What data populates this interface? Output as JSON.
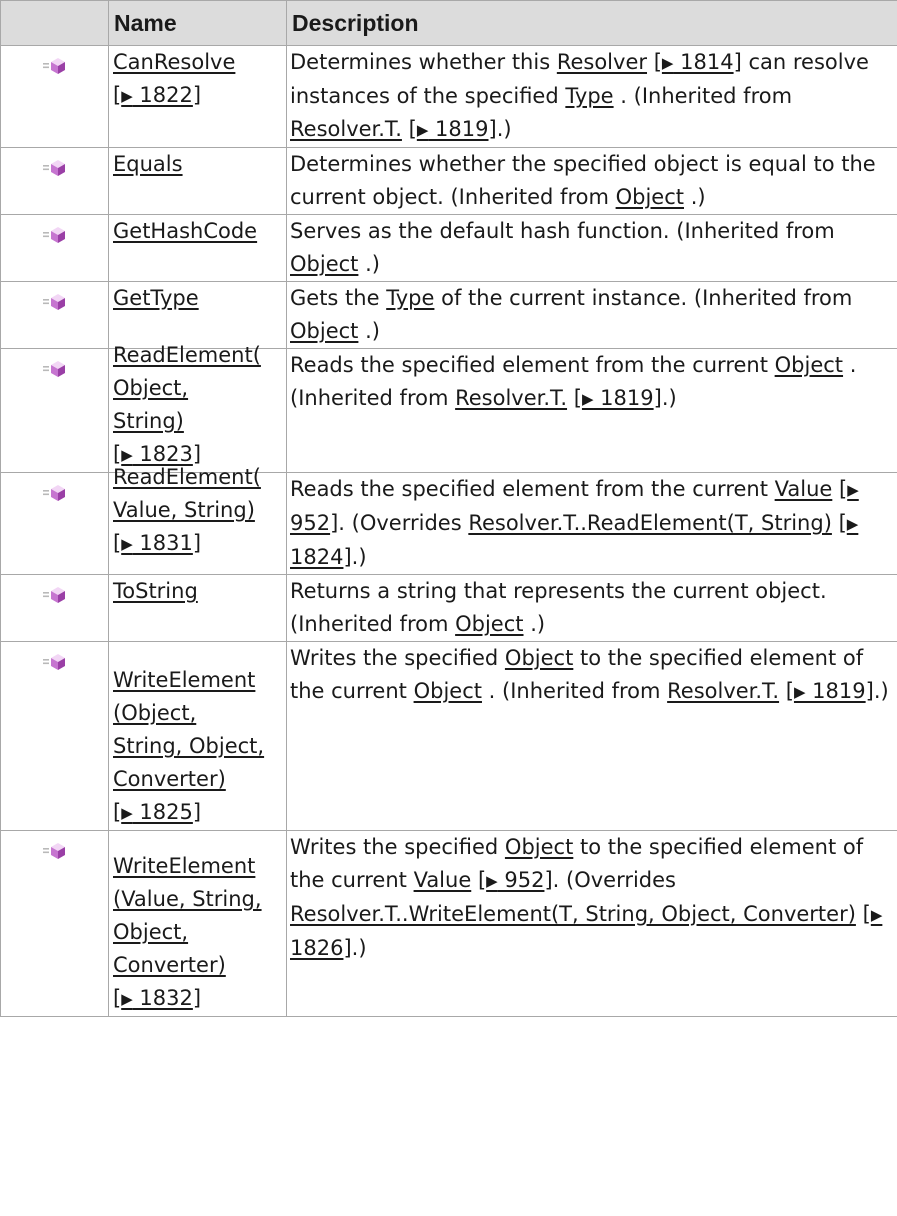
{
  "table": {
    "headers": {
      "icon": "",
      "name": "Name",
      "description": "Description"
    },
    "rows": [
      {
        "name": "CanResolve",
        "name_ref": "1822",
        "desc": [
          {
            "t": "Determines whether this "
          },
          {
            "t": "Resolver",
            "link": true
          },
          {
            "ref": "1814"
          },
          {
            "t": " can resolve instances of the specified "
          },
          {
            "t": "Type",
            "link": true
          },
          {
            "t": ". (Inherited from "
          },
          {
            "t": "Resolver.T.",
            "link": true
          },
          {
            "ref": "1819"
          },
          {
            "t": ".)"
          }
        ]
      },
      {
        "name": "Equals",
        "desc": [
          {
            "t": "Determines whether the specified object is equal to the current object. (Inherited from "
          },
          {
            "t": "Object",
            "link": true
          },
          {
            "t": ".)"
          }
        ]
      },
      {
        "name": "GetHashCode",
        "desc": [
          {
            "t": "Serves as the default hash function. (Inherited from "
          },
          {
            "t": "Object",
            "link": true
          },
          {
            "t": ".)"
          }
        ]
      },
      {
        "name": "GetType",
        "desc": [
          {
            "t": "Gets the "
          },
          {
            "t": "Type",
            "link": true
          },
          {
            "t": " of the current instance. (Inherited from "
          },
          {
            "t": "Object",
            "link": true
          },
          {
            "t": ".)"
          }
        ]
      },
      {
        "name_lines": [
          "ReadElement(",
          "Object,",
          "String)"
        ],
        "name_ref": "1823",
        "desc": [
          {
            "t": "Reads the specified element from the current "
          },
          {
            "t": "Object",
            "link": true
          },
          {
            "t": ". (Inherited from "
          },
          {
            "t": "Resolver.T.",
            "link": true
          },
          {
            "ref": "1819"
          },
          {
            "t": ".)"
          }
        ]
      },
      {
        "name_lines": [
          "ReadElement(",
          "Value, String)"
        ],
        "name_ref": "1831",
        "desc": [
          {
            "t": "Reads the specified element from the current "
          },
          {
            "t": "Value",
            "link": true
          },
          {
            "ref": "952"
          },
          {
            "t": ". (Overrides "
          },
          {
            "t": "Resolver.T..ReadElement(T, String)",
            "link": true
          },
          {
            "ref": "1824"
          },
          {
            "t": ".)"
          }
        ]
      },
      {
        "name": "ToString",
        "desc": [
          {
            "t": "Returns a string that represents the current object. (Inherited from "
          },
          {
            "t": "Object",
            "link": true
          },
          {
            "t": ".)"
          }
        ]
      },
      {
        "name_lines": [
          "WriteElement",
          "(Object,",
          "String, Object,",
          "Converter)"
        ],
        "name_ref": "1825",
        "desc": [
          {
            "t": "Writes the specified "
          },
          {
            "t": "Object",
            "link": true
          },
          {
            "t": " to the specified element of the current "
          },
          {
            "t": "Object",
            "link": true
          },
          {
            "t": ". (Inherited from "
          },
          {
            "t": "Resolver.T.",
            "link": true
          },
          {
            "ref": "1819"
          },
          {
            "t": ".)"
          }
        ]
      },
      {
        "name_lines": [
          "WriteElement",
          "(Value, String,",
          "Object,",
          "Converter)"
        ],
        "name_ref": "1832",
        "desc": [
          {
            "t": "Writes the specified "
          },
          {
            "t": "Object",
            "link": true
          },
          {
            "t": " to the specified element of the current "
          },
          {
            "t": "Value",
            "link": true
          },
          {
            "ref": "952"
          },
          {
            "t": ". (Overrides "
          },
          {
            "t": "Resolver.T..WriteElement(T, String, Object, Converter)",
            "link": true
          },
          {
            "ref": "1826"
          },
          {
            "t": ".)"
          }
        ]
      }
    ]
  },
  "icon": {
    "name": "public-method-icon",
    "colors": {
      "lines": "#b9b9b9",
      "cube_top": "#f2d6f5",
      "cube_left": "#c675d0",
      "cube_right": "#9a3fa6"
    }
  },
  "ref_arrow": "▶"
}
